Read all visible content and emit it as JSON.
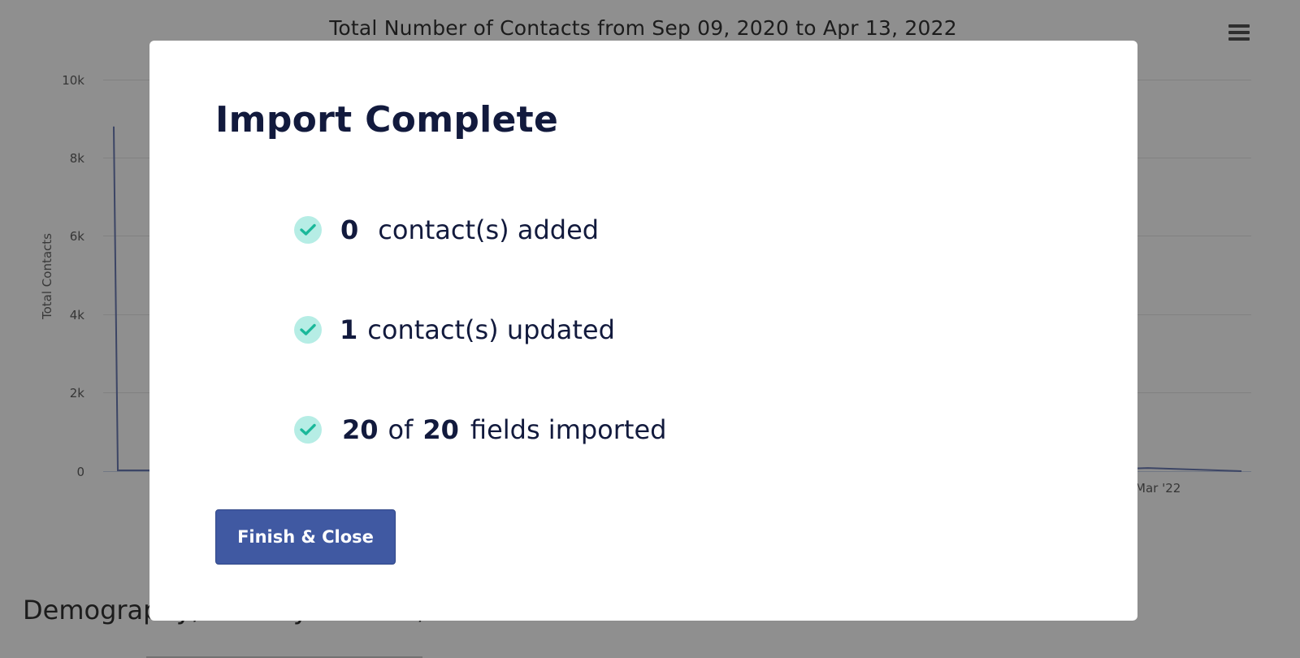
{
  "background": {
    "chart_title": "Total Number of Contacts from Sep 09, 2020 to Apr 13, 2022",
    "section_heading": "Demography, Primary Interest, Source & Custom Fields"
  },
  "chart_data": {
    "type": "line",
    "title": "Total Number of Contacts from Sep 09, 2020 to Apr 13, 2022",
    "ylabel": "Total Contacts",
    "xlabel": "",
    "ylim": [
      0,
      10000
    ],
    "y_ticks": [
      "10k",
      "8k",
      "6k",
      "4k",
      "2k",
      "0"
    ],
    "x_ticks_visible": [
      "Mar '22"
    ],
    "grid": true,
    "series": [
      {
        "color": "#6b7bb5",
        "values": [
          8800,
          20,
          20,
          0,
          0,
          0,
          0,
          0,
          0,
          0,
          0,
          0,
          80,
          0
        ]
      }
    ]
  },
  "modal": {
    "title": "Import Complete",
    "results": [
      {
        "count": "0",
        "text": "contact(s) added"
      },
      {
        "count": "1",
        "text": "contact(s) updated"
      },
      {
        "count": "20",
        "of_text": "of",
        "total": "20",
        "text": "fields imported"
      }
    ],
    "finish_button": "Finish & Close",
    "icon": "check-icon"
  },
  "colors": {
    "primary_button": "#4059a2",
    "check_bg": "#b6ede5",
    "check_mark": "#1ab89a",
    "title_text": "#121a3d"
  }
}
